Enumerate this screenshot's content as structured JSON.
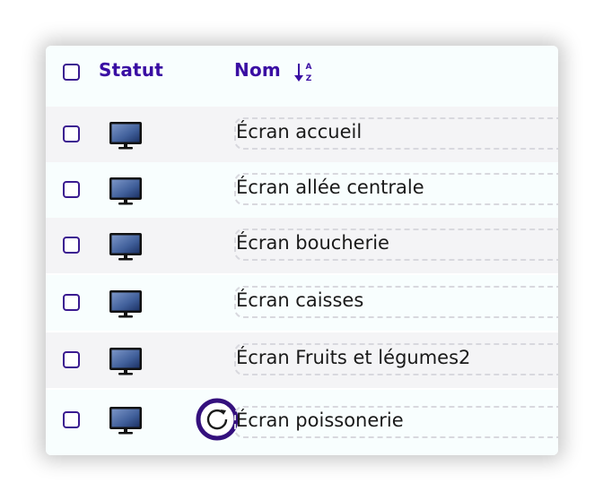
{
  "table": {
    "header": {
      "statut_label": "Statut",
      "nom_label": "Nom",
      "sort_icon": "sort-alpha-down-icon"
    },
    "rows": [
      {
        "name": "Écran accueil",
        "status_icon": "monitor-icon"
      },
      {
        "name": "Écran allée centrale",
        "status_icon": "monitor-icon"
      },
      {
        "name": "Écran boucherie",
        "status_icon": "monitor-icon"
      },
      {
        "name": "Écran caisses",
        "status_icon": "monitor-icon"
      },
      {
        "name": "Écran Fruits et légumes2",
        "status_icon": "monitor-icon"
      },
      {
        "name": "Écran poissonerie",
        "status_icon": "monitor-icon",
        "loading_icon": "loading-spinner-icon"
      }
    ]
  },
  "colors": {
    "accent": "#3a0ea3",
    "checkbox_border": "#3a1a90",
    "row_alt": "#f4f4f6",
    "row_base": "#f8fefe"
  }
}
